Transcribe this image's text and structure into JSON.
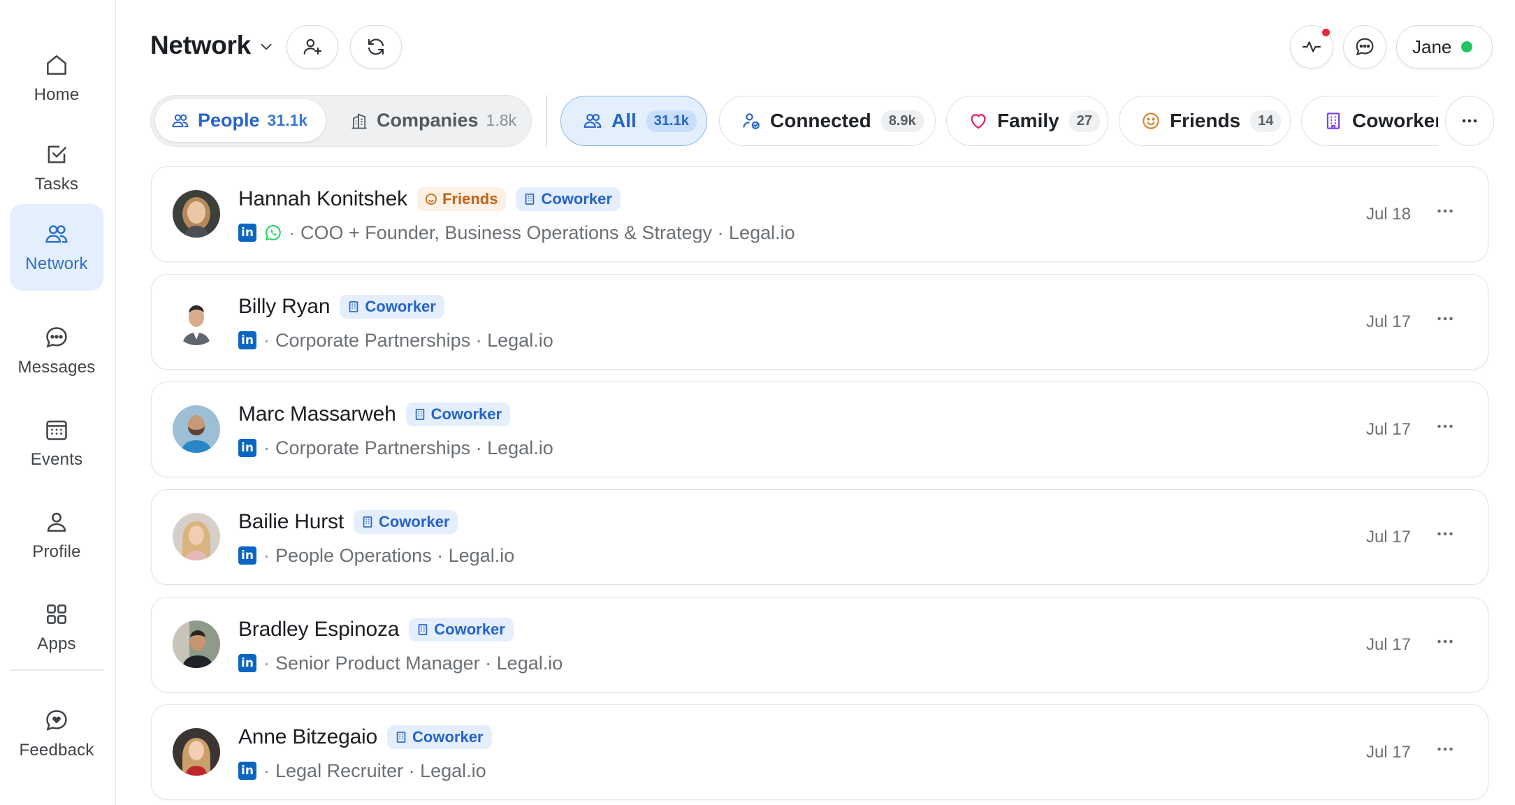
{
  "sidebar": {
    "items": [
      {
        "label": "Home",
        "icon": "home-icon"
      },
      {
        "label": "Tasks",
        "icon": "tasks-icon"
      },
      {
        "label": "Network",
        "icon": "network-icon",
        "active": true
      },
      {
        "label": "Messages",
        "icon": "messages-icon"
      },
      {
        "label": "Events",
        "icon": "calendar-icon"
      },
      {
        "label": "Profile",
        "icon": "profile-icon"
      },
      {
        "label": "Apps",
        "icon": "apps-icon"
      }
    ],
    "feedback": {
      "label": "Feedback",
      "icon": "feedback-icon"
    }
  },
  "header": {
    "title": "Network",
    "user": {
      "name": "Jane",
      "status_color": "#22c55e"
    },
    "notification_color": "#e5263b"
  },
  "segments": [
    {
      "label": "People",
      "count": "31.1k",
      "active": true
    },
    {
      "label": "Companies",
      "count": "1.8k",
      "active": false
    }
  ],
  "filters": [
    {
      "label": "All",
      "count": "31.1k",
      "active": true
    },
    {
      "label": "Connected",
      "count": "8.9k"
    },
    {
      "label": "Family",
      "count": "27"
    },
    {
      "label": "Friends",
      "count": "14"
    },
    {
      "label": "Coworker"
    }
  ],
  "tags": {
    "friends": "Friends",
    "coworker": "Coworker"
  },
  "rows": [
    {
      "name": "Hannah Konitshek",
      "subtitle": "COO + Founder, Business Operations & Strategy · Legal.io",
      "date": "Jul 18"
    },
    {
      "name": "Billy Ryan",
      "subtitle": "Corporate Partnerships · Legal.io",
      "date": "Jul 17"
    },
    {
      "name": "Marc Massarweh",
      "subtitle": "Corporate Partnerships · Legal.io",
      "date": "Jul 17"
    },
    {
      "name": "Bailie Hurst",
      "subtitle": "People Operations · Legal.io",
      "date": "Jul 17"
    },
    {
      "name": "Bradley Espinoza",
      "subtitle": "Senior Product Manager · Legal.io",
      "date": "Jul 17"
    },
    {
      "name": "Anne Bitzegaio",
      "subtitle": "Legal Recruiter · Legal.io",
      "date": "Jul 17"
    }
  ],
  "colors": {
    "accent": "#2563c9",
    "active_bg": "#e3effc",
    "linkedin": "#0a66c2",
    "whatsapp": "#25d366",
    "friends_tag": "#c26312"
  }
}
